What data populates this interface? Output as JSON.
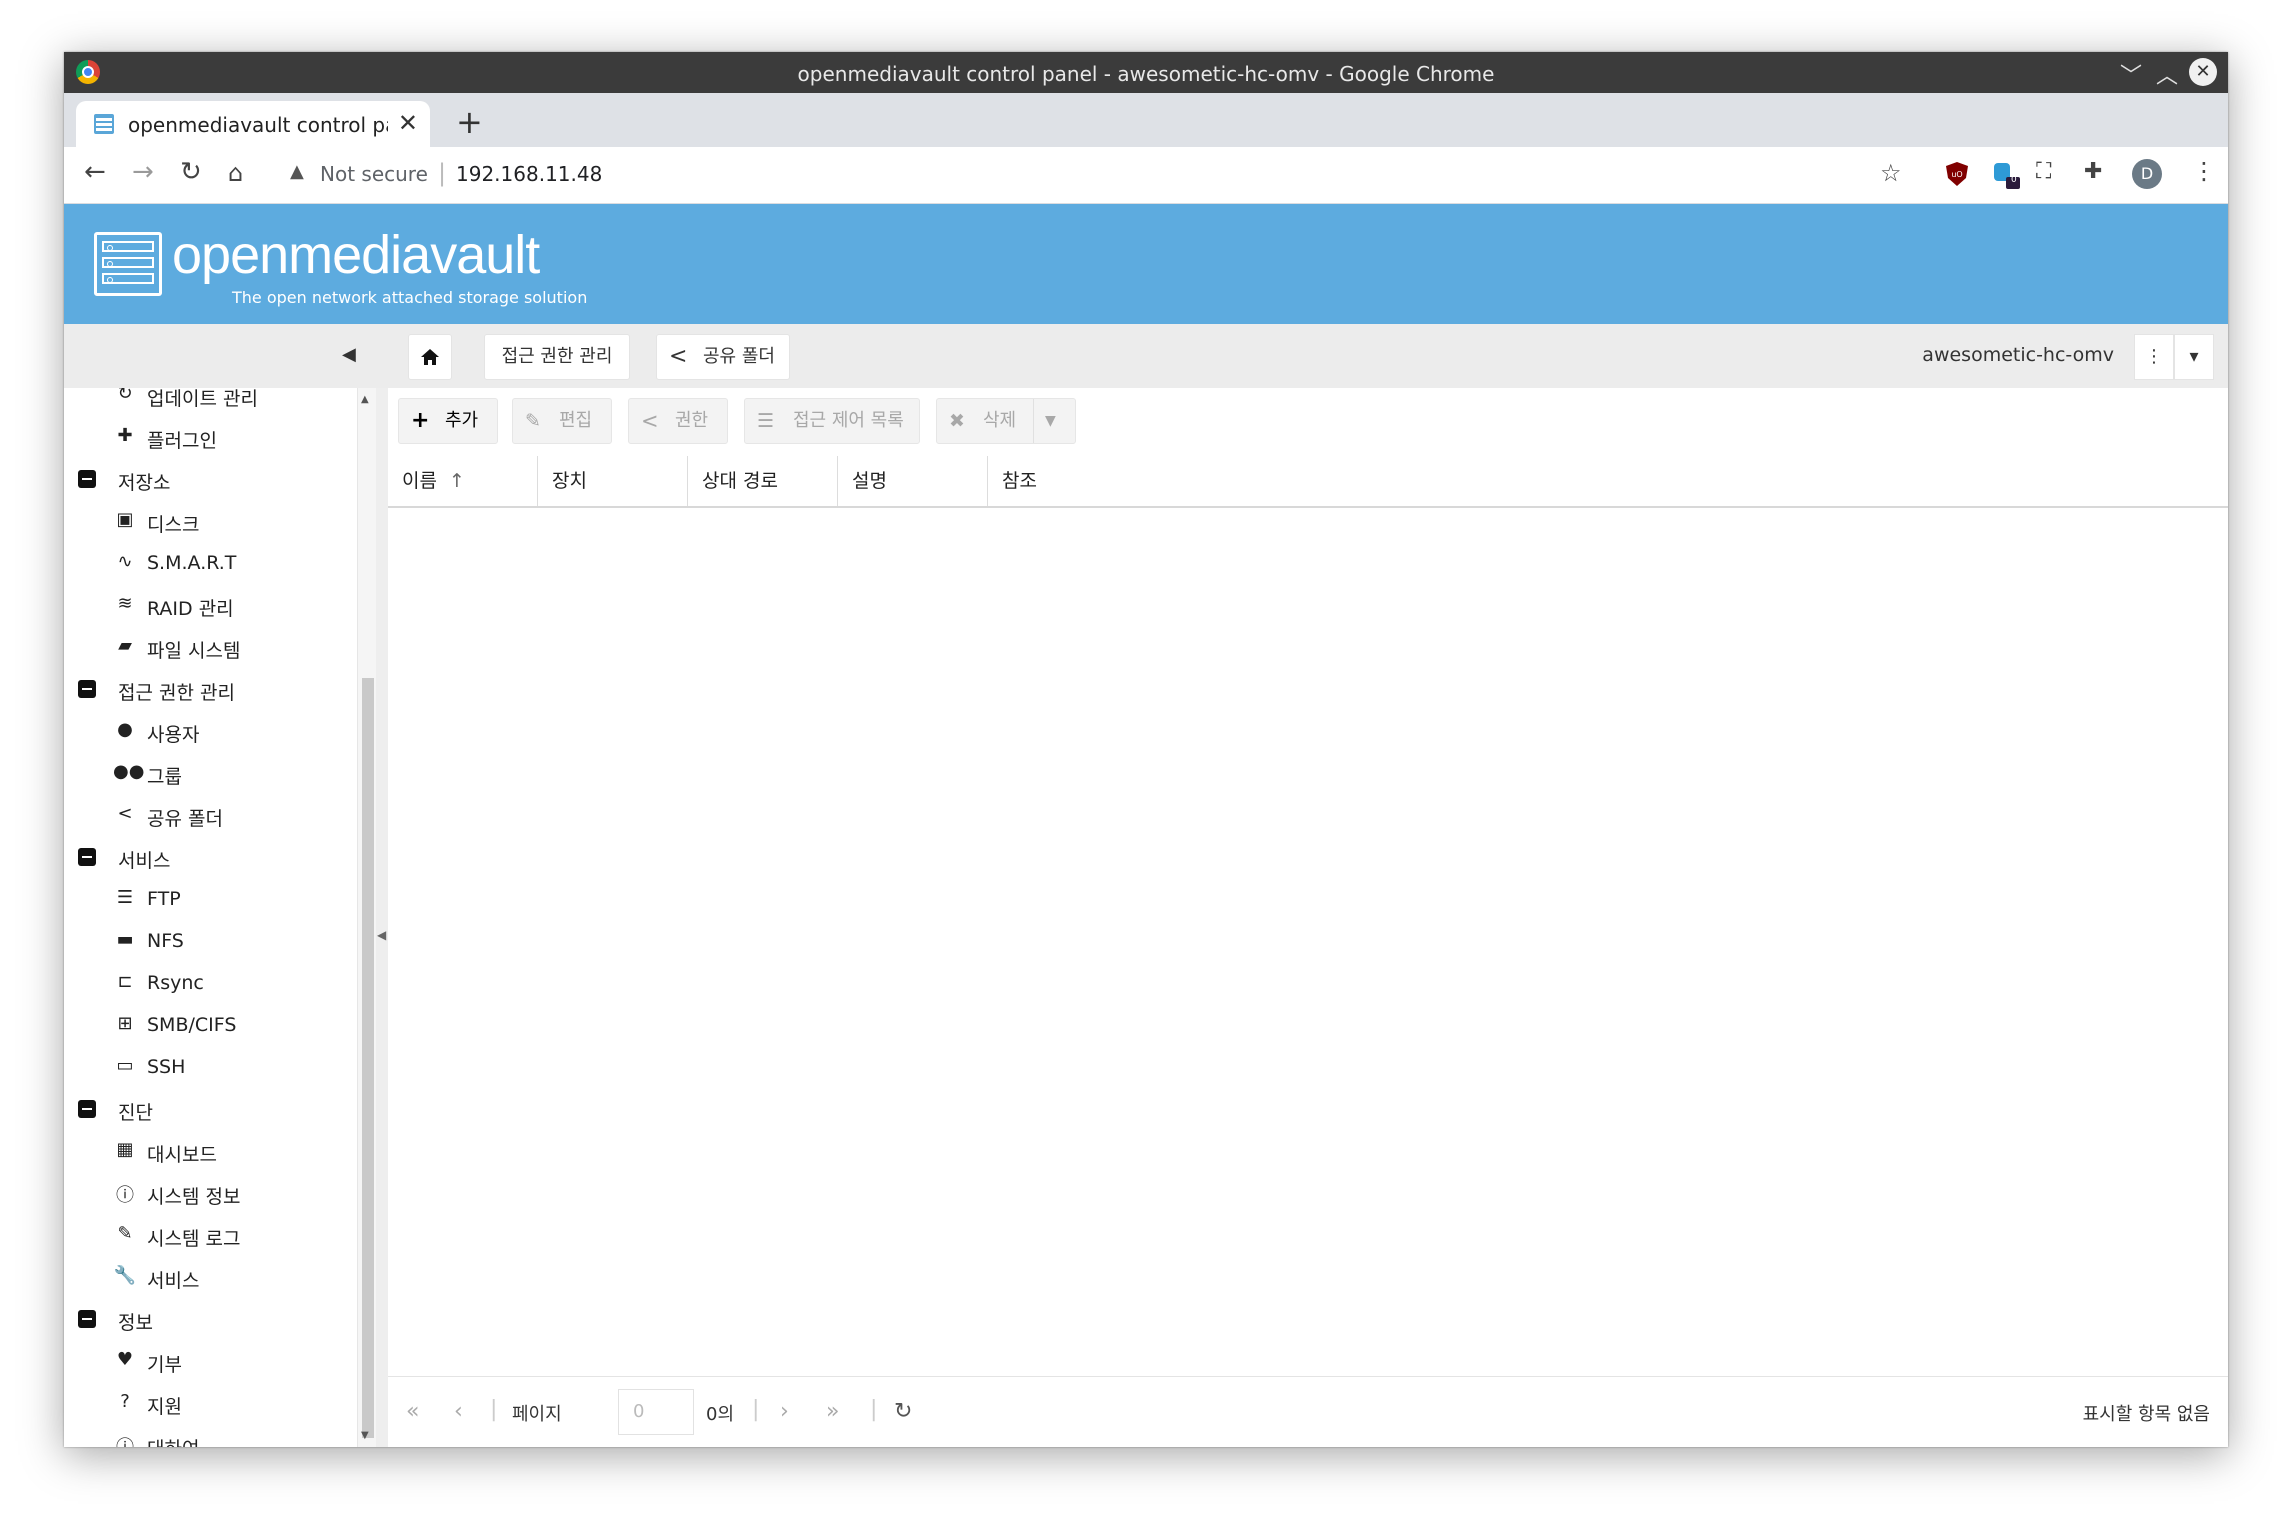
{
  "window": {
    "title": "openmediavault control panel - awesometic-hc-omv - Google Chrome",
    "controls": {
      "minimize": "﹀",
      "maximize": "︿",
      "close": "✕"
    }
  },
  "browser": {
    "tab_title": "openmediavault control panel - awesometic-hc-omv",
    "tab_close": "✕",
    "new_tab": "+",
    "security_label": "Not secure",
    "url": "192.168.11.48",
    "avatar_initial": "D",
    "ext_badge": "0"
  },
  "omv": {
    "logo_text": "openmediavault",
    "tagline": "The open network attached storage solution",
    "hostname": "awesometic-hc-omv"
  },
  "breadcrumb": {
    "section": "접근 권한 관리",
    "current": "공유 폴더"
  },
  "sidebar": {
    "rows": [
      {
        "kind": "item",
        "icon": "refresh-icon",
        "glyph": "↻",
        "label": "업데이트 관리"
      },
      {
        "kind": "item",
        "icon": "puzzle-icon",
        "glyph": "✚",
        "label": "플러그인"
      },
      {
        "kind": "cat",
        "label": "저장소"
      },
      {
        "kind": "item",
        "icon": "disk-icon",
        "glyph": "▣",
        "label": "디스크"
      },
      {
        "kind": "item",
        "icon": "heartbeat-icon",
        "glyph": "∿",
        "label": "S.M.A.R.T"
      },
      {
        "kind": "item",
        "icon": "database-icon",
        "glyph": "≋",
        "label": "RAID 관리"
      },
      {
        "kind": "item",
        "icon": "folders-icon",
        "glyph": "▰",
        "label": "파일 시스템"
      },
      {
        "kind": "cat",
        "label": "접근 권한 관리"
      },
      {
        "kind": "item",
        "icon": "user-icon",
        "glyph": "●",
        "label": "사용자"
      },
      {
        "kind": "item",
        "icon": "users-icon",
        "glyph": "●●",
        "label": "그룹"
      },
      {
        "kind": "item",
        "icon": "share-icon",
        "glyph": "<",
        "label": "공유 폴더"
      },
      {
        "kind": "cat",
        "label": "서비스"
      },
      {
        "kind": "item",
        "icon": "server-icon",
        "glyph": "☰",
        "label": "FTP"
      },
      {
        "kind": "item",
        "icon": "desktop-icon",
        "glyph": "▬",
        "label": "NFS"
      },
      {
        "kind": "item",
        "icon": "sitemap-icon",
        "glyph": "⊏",
        "label": "Rsync"
      },
      {
        "kind": "item",
        "icon": "windows-icon",
        "glyph": "⊞",
        "label": "SMB/CIFS"
      },
      {
        "kind": "item",
        "icon": "terminal-icon",
        "glyph": "▭",
        "label": "SSH"
      },
      {
        "kind": "cat",
        "label": "진단"
      },
      {
        "kind": "item",
        "icon": "dashboard-icon",
        "glyph": "▦",
        "label": "대시보드"
      },
      {
        "kind": "item",
        "icon": "info-icon",
        "glyph": "ⓘ",
        "label": "시스템 정보"
      },
      {
        "kind": "item",
        "icon": "edit-icon",
        "glyph": "✎",
        "label": "시스템 로그"
      },
      {
        "kind": "item",
        "icon": "wrench-icon",
        "glyph": "🔧",
        "label": "서비스"
      },
      {
        "kind": "cat",
        "label": "정보"
      },
      {
        "kind": "item",
        "icon": "heart-icon",
        "glyph": "♥",
        "label": "기부"
      },
      {
        "kind": "item",
        "icon": "help-icon",
        "glyph": "?",
        "label": "지원"
      },
      {
        "kind": "item",
        "icon": "info-icon",
        "glyph": "ⓘ",
        "label": "대하여"
      }
    ]
  },
  "actions": {
    "add": "추가",
    "edit": "편집",
    "privileges": "권한",
    "acl": "접근 제어 목록",
    "delete": "삭제"
  },
  "grid": {
    "columns": [
      "이름",
      "장치",
      "상대 경로",
      "설명",
      "참조"
    ],
    "sort_indicator": "↑"
  },
  "pager": {
    "page_label": "페이지",
    "page_value": "0",
    "of_label": "0의",
    "empty_message": "표시할 항목 없음"
  }
}
